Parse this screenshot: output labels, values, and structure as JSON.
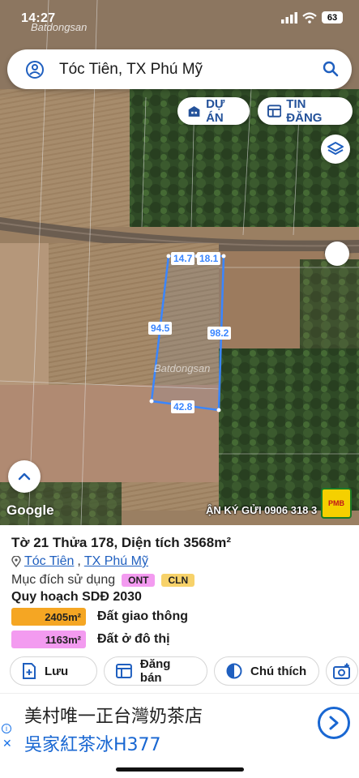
{
  "status": {
    "time": "14:27",
    "battery": "63"
  },
  "watermark": "Batdongsan",
  "search": {
    "query": "Tóc Tiên, TX Phú Mỹ"
  },
  "pills": {
    "du_an": "DỰ ÁN",
    "tin_dang": "TIN ĐĂNG"
  },
  "plot": {
    "dims": {
      "top_left": "14.7",
      "top_right": "18.1",
      "left": "94.5",
      "right": "98.2",
      "bottom": "42.8"
    }
  },
  "map_footer": {
    "google": "Google",
    "contact": "ẬN KÝ GỬI 0906 318 3",
    "logo": "PMB"
  },
  "parcel": {
    "title": "Tờ 21 Thửa 178, Diện tích 3568m²",
    "location_a": "Tóc Tiên",
    "location_sep": ",",
    "location_b": "TX Phú Mỹ",
    "purpose_label": "Mục đích sử dụng",
    "purpose_tags": [
      "ONT",
      "CLN"
    ],
    "plan_title": "Quy hoạch SDĐ 2030",
    "plan_rows": [
      {
        "area": "2405m²",
        "label": "Đất giao thông",
        "color": "#f5a623"
      },
      {
        "area": "1163m²",
        "label": "Đất ở đô thị",
        "color": "#f39bf0"
      }
    ]
  },
  "actions": {
    "save": "Lưu",
    "post": "Đăng bán",
    "note": "Chú thích"
  },
  "ad": {
    "line1": "美村唯一正台灣奶茶店",
    "line2": "吳家紅茶冰H377"
  },
  "colors": {
    "accent": "#1f5fbf",
    "plot_line": "#3a86ff",
    "ont": "#f39bf0",
    "cln": "#f7d26a"
  }
}
